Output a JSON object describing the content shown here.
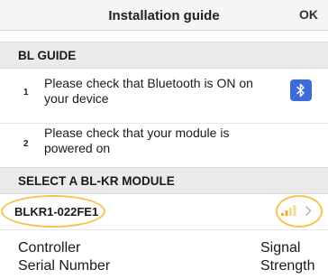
{
  "navbar": {
    "title": "Installation guide",
    "ok_label": "OK"
  },
  "guide": {
    "header": "BL GUIDE",
    "steps": [
      {
        "number": "1",
        "text": "Please check that Bluetooth is ON on your device",
        "icon": "bluetooth-icon"
      },
      {
        "number": "2",
        "text": "Please check that your module is powered on"
      }
    ]
  },
  "select": {
    "header": "SELECT A BL-KR MODULE",
    "modules": [
      {
        "name": "BLKR1-022FE1",
        "signal_bars_filled": 2,
        "signal_bars_total": 4
      }
    ]
  },
  "annotations": {
    "left_line1": "Controller",
    "left_line2": "Serial Number",
    "right_line1": "Signal",
    "right_line2": "Strength"
  },
  "colors": {
    "highlight": "#f5c44a",
    "bluetooth": "#3d6bd8",
    "signal": "#f0b020"
  }
}
